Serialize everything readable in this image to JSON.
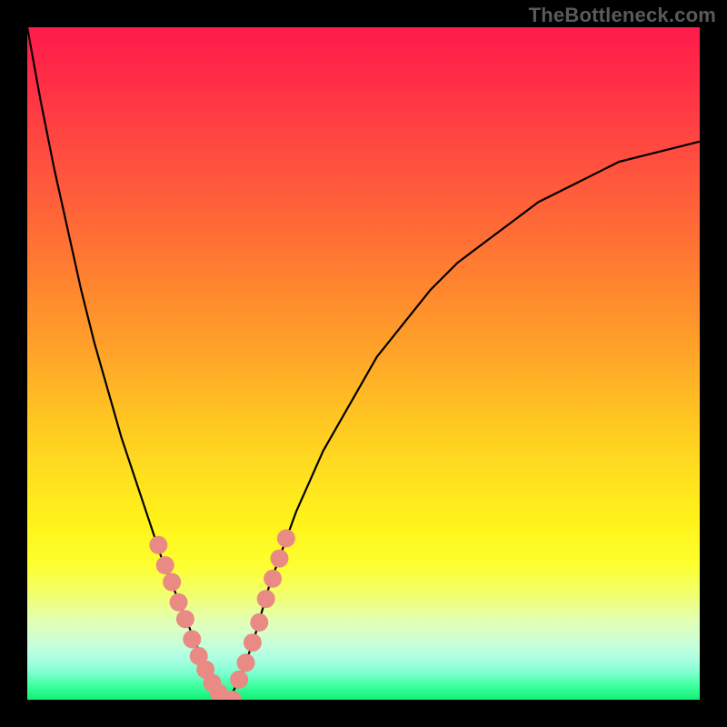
{
  "watermark": "TheBottleneck.com",
  "colors": {
    "frame_bg": "#000000",
    "curve_stroke": "#000000",
    "marker_fill": "#ea8a84",
    "gradient_top": "#ff1a4b",
    "gradient_bottom": "#11f075"
  },
  "chart_data": {
    "type": "line",
    "title": "",
    "xlabel": "",
    "ylabel": "",
    "xlim": [
      0,
      100
    ],
    "ylim": [
      0,
      100
    ],
    "grid": false,
    "legend": false,
    "x": [
      0,
      2,
      4,
      6,
      8,
      10,
      12,
      14,
      16,
      18,
      20,
      22,
      24,
      26,
      27,
      28,
      29,
      30,
      32,
      34,
      36,
      40,
      44,
      48,
      52,
      56,
      60,
      64,
      68,
      72,
      76,
      80,
      84,
      88,
      92,
      96,
      100
    ],
    "y": [
      100,
      89,
      79,
      70,
      61,
      53,
      46,
      39,
      33,
      27,
      21,
      16,
      11,
      6,
      4,
      2,
      1,
      0,
      4,
      10,
      17,
      28,
      37,
      44,
      51,
      56,
      61,
      65,
      68,
      71,
      74,
      76,
      78,
      80,
      81,
      82,
      83
    ],
    "annotations": [],
    "series": [
      {
        "name": "curve",
        "type": "line",
        "x_ref": "x",
        "y_ref": "y"
      },
      {
        "name": "markers",
        "type": "scatter",
        "points": [
          {
            "x": 19.5,
            "y": 23
          },
          {
            "x": 20.5,
            "y": 20
          },
          {
            "x": 21.5,
            "y": 17.5
          },
          {
            "x": 22.5,
            "y": 14.5
          },
          {
            "x": 23.5,
            "y": 12
          },
          {
            "x": 24.5,
            "y": 9
          },
          {
            "x": 25.5,
            "y": 6.5
          },
          {
            "x": 26.5,
            "y": 4.5
          },
          {
            "x": 27.5,
            "y": 2.5
          },
          {
            "x": 28.5,
            "y": 1
          },
          {
            "x": 29.5,
            "y": 0
          },
          {
            "x": 30.5,
            "y": 0
          },
          {
            "x": 31.5,
            "y": 3
          },
          {
            "x": 32.5,
            "y": 5.5
          },
          {
            "x": 33.5,
            "y": 8.5
          },
          {
            "x": 34.5,
            "y": 11.5
          },
          {
            "x": 35.5,
            "y": 15
          },
          {
            "x": 36.5,
            "y": 18
          },
          {
            "x": 37.5,
            "y": 21
          },
          {
            "x": 38.5,
            "y": 24
          }
        ]
      }
    ]
  }
}
